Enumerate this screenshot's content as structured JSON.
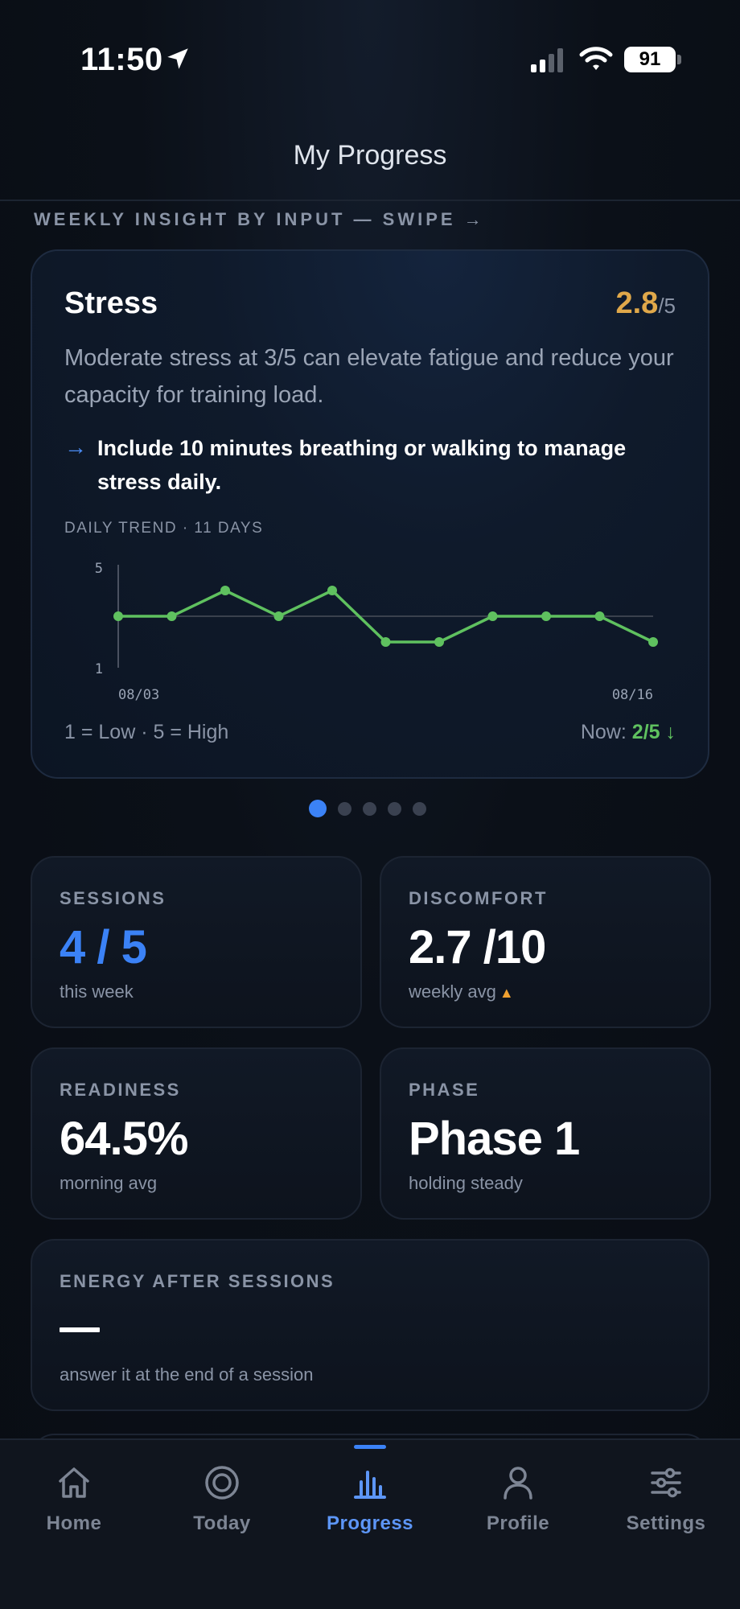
{
  "status_bar": {
    "time": "11:50",
    "battery": "91"
  },
  "header": {
    "title": "My Progress"
  },
  "section_label": "WEEKLY INSIGHT BY INPUT — SWIPE →",
  "insight": {
    "title": "Stress",
    "score": "2.8",
    "score_denominator": "/5",
    "description": "Moderate stress at 3/5 can elevate fatigue and reduce your capacity for training load.",
    "tip_arrow": "→",
    "tip": "Include 10 minutes breathing or walking to manage stress daily.",
    "trend_label": "DAILY TREND · 11 DAYS",
    "legend": "1 = Low · 5 = High",
    "now_label": "Now:",
    "now_value": "2/5 ↓",
    "accent_color": "#e0a84a",
    "line_color": "#5fc15f"
  },
  "chart_data": {
    "type": "line",
    "x_labels": [
      "08/03",
      "08/16"
    ],
    "y_ticks": [
      "5",
      "1"
    ],
    "ylim": [
      1,
      5
    ],
    "reference_line": 3,
    "series": [
      {
        "values": [
          3,
          3,
          4,
          3,
          4,
          2,
          2,
          3,
          3,
          3,
          2
        ]
      }
    ]
  },
  "pager": {
    "count": 5,
    "active": 0
  },
  "stats": {
    "sessions": {
      "label": "SESSIONS",
      "value": "4 / 5",
      "sub": "this week"
    },
    "discomfort": {
      "label": "DISCOMFORT",
      "value": "2.7 /10",
      "sub": "weekly avg",
      "flag": "▲"
    },
    "readiness": {
      "label": "READINESS",
      "value": "64.5%",
      "sub": "morning avg"
    },
    "phase": {
      "label": "PHASE",
      "value": "Phase 1",
      "sub": "holding steady"
    },
    "energy": {
      "label": "ENERGY AFTER SESSIONS",
      "sub": "answer it at the end of a session"
    }
  },
  "tabs": [
    {
      "label": "Home",
      "icon": "home-icon"
    },
    {
      "label": "Today",
      "icon": "target-icon"
    },
    {
      "label": "Progress",
      "icon": "bar-chart-icon",
      "active": true
    },
    {
      "label": "Profile",
      "icon": "person-icon"
    },
    {
      "label": "Settings",
      "icon": "sliders-icon"
    }
  ]
}
